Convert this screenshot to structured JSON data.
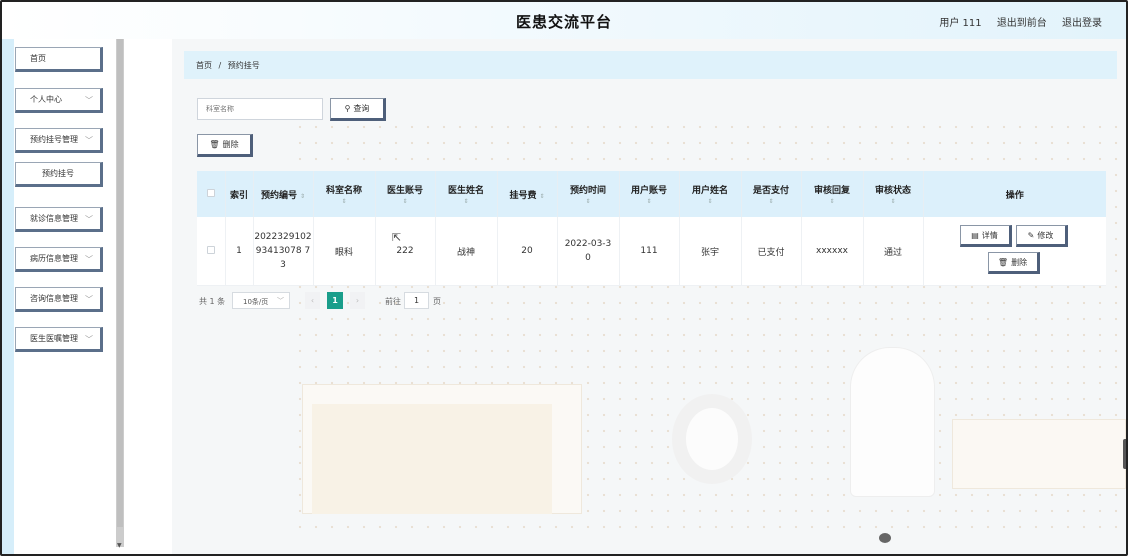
{
  "header": {
    "title": "医患交流平台",
    "user_label": "用户 111",
    "to_front": "退出到前台",
    "logout": "退出登录"
  },
  "sidebar": {
    "items": [
      {
        "label": "首页",
        "has_chevron": false
      },
      {
        "label": "个人中心",
        "has_chevron": true
      },
      {
        "label": "预约挂号管理",
        "has_chevron": true
      },
      {
        "label": "预约挂号",
        "has_chevron": false,
        "sub": true
      },
      {
        "label": "就诊信息管理",
        "has_chevron": true
      },
      {
        "label": "病历信息管理",
        "has_chevron": true
      },
      {
        "label": "咨询信息管理",
        "has_chevron": true
      },
      {
        "label": "医生医嘱管理",
        "has_chevron": true
      }
    ]
  },
  "breadcrumb": {
    "home": "首页",
    "sep": "/",
    "current": "预约挂号"
  },
  "search": {
    "placeholder": "科室名称",
    "button": "查询"
  },
  "toolbar": {
    "delete_label": "删除"
  },
  "table": {
    "columns": [
      "索引",
      "预约编号",
      "科室名称",
      "医生账号",
      "医生姓名",
      "挂号费",
      "预约时间",
      "用户账号",
      "用户姓名",
      "是否支付",
      "审核回复",
      "审核状态",
      "操作"
    ],
    "rows": [
      {
        "index": "1",
        "booking_no": "202232910293413078 73",
        "department": "眼科",
        "doctor_account": "222",
        "doctor_name": "战神",
        "fee": "20",
        "time": "2022-03-30",
        "user_account": "111",
        "user_name": "张宇",
        "paid": "已支付",
        "reply": "xxxxxx",
        "status": "通过"
      }
    ],
    "actions": {
      "detail": "详情",
      "edit": "修改",
      "delete": "删除"
    }
  },
  "pager": {
    "total": "共 1 条",
    "page_size": "10条/页",
    "prev": "‹",
    "current": "1",
    "next": "›",
    "goto": "前往",
    "goto_value": "1",
    "page_word": "页"
  },
  "icons": {
    "search": "search-icon",
    "delete": "trash-icon",
    "detail": "doc-icon",
    "edit": "pencil-icon",
    "chevron": "chevron-down-icon"
  },
  "colors": {
    "accent": "#1a9e8b",
    "header_bg": "#dff2fb",
    "button_shadow": "#4e5f7a"
  }
}
